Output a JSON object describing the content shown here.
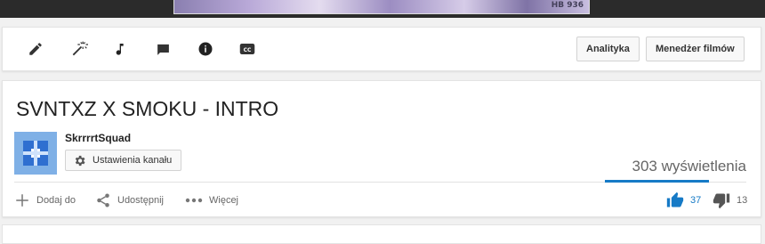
{
  "player": {
    "watermark": "HB 936"
  },
  "toolbar": {
    "icons": [
      "pencil-icon",
      "magic-wand-icon",
      "music-note-icon",
      "comment-icon",
      "info-icon",
      "cc-icon"
    ],
    "analytics_label": "Analityka",
    "video_manager_label": "Menedżer filmów"
  },
  "video": {
    "title": "SVNTXZ X SMOKU - INTRO",
    "channel_name": "SkrrrrtSquad",
    "channel_settings_label": "Ustawienia kanału",
    "views": "303 wyświetlenia",
    "like_ratio": 0.74
  },
  "actions": {
    "add_to_label": "Dodaj do",
    "share_label": "Udostępnij",
    "more_label": "Więcej"
  },
  "rating": {
    "likes": "37",
    "dislikes": "13"
  },
  "colors": {
    "accent": "#167ac6",
    "avatar_bg": "#7fb0e6"
  }
}
